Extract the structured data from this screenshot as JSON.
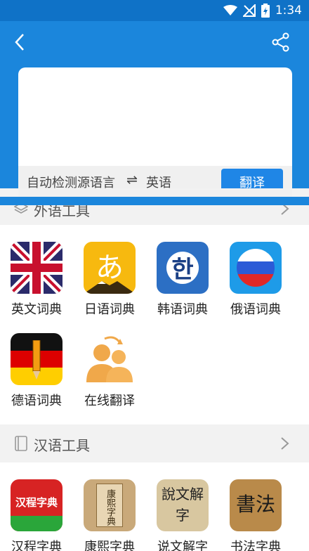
{
  "status_bar": {
    "time": "1:34"
  },
  "translator": {
    "source_lang": "自动检测源语言",
    "swap_symbol": "⇌",
    "target_lang": "英语",
    "translate_label": "翻译",
    "input_value": ""
  },
  "sections": {
    "foreign": {
      "title": "外语工具",
      "items": [
        {
          "label": "英文词典"
        },
        {
          "label": "日语词典",
          "glyph": "あ"
        },
        {
          "label": "韩语词典",
          "glyph": "한"
        },
        {
          "label": "俄语词典"
        },
        {
          "label": "德语词典"
        },
        {
          "label": "在线翻译"
        }
      ]
    },
    "chinese": {
      "title": "汉语工具",
      "items": [
        {
          "label": "汉程字典",
          "logo_text": "汉程字典"
        },
        {
          "label": "康熙字典",
          "logo_text": "康熙字典"
        },
        {
          "label": "说文解字",
          "logo_text": "說文解字"
        },
        {
          "label": "书法字典",
          "logo_text": "書法"
        }
      ]
    }
  },
  "colors": {
    "primary": "#1b86dc",
    "status": "#0f72c7",
    "button": "#1f86e6"
  }
}
